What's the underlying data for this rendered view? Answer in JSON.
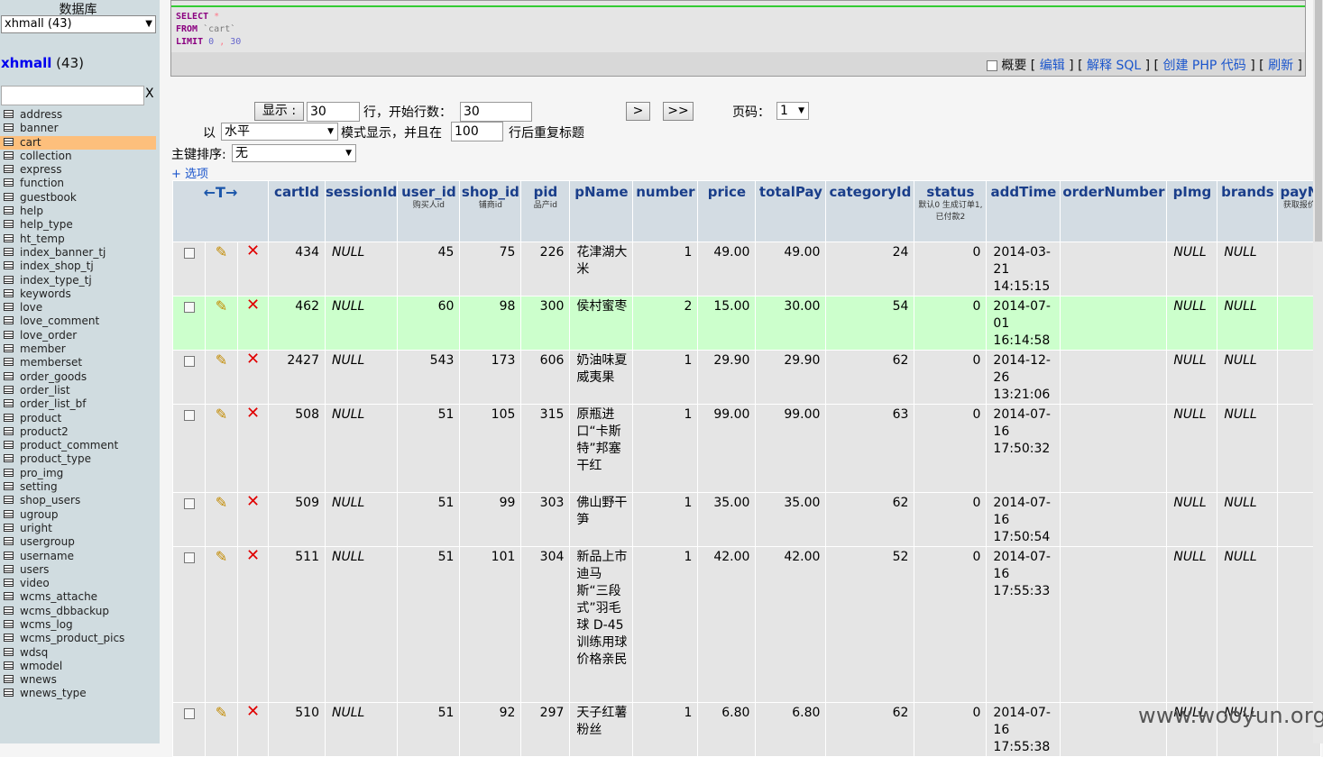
{
  "sidebar": {
    "db_label": "数据库",
    "db_select": "xhmall (43)",
    "db_name": "xhmall",
    "db_count": "(43)",
    "filter_value": "",
    "filter_clear": "X",
    "tables": [
      "address",
      "banner",
      "cart",
      "collection",
      "express",
      "function",
      "guestbook",
      "help",
      "help_type",
      "ht_temp",
      "index_banner_tj",
      "index_shop_tj",
      "index_type_tj",
      "keywords",
      "love",
      "love_comment",
      "love_order",
      "member",
      "memberset",
      "order_goods",
      "order_list",
      "order_list_bf",
      "product",
      "product2",
      "product_comment",
      "product_type",
      "pro_img",
      "setting",
      "shop_users",
      "ugroup",
      "uright",
      "usergroup",
      "username",
      "users",
      "video",
      "wcms_attache",
      "wcms_dbbackup",
      "wcms_log",
      "wcms_product_pics",
      "wdsq",
      "wmodel",
      "wnews",
      "wnews_type"
    ],
    "active_table": "cart"
  },
  "sql": {
    "select_kw": "SELECT",
    "star": "*",
    "from_kw": "FROM",
    "table": "`cart`",
    "limit_kw": "LIMIT",
    "limit_a": "0",
    "limit_b": "30",
    "profile_label": "概要",
    "bracket_open": "[",
    "bracket_close": "]",
    "edit": "编辑",
    "explain": "解释 SQL",
    "php": "创建 PHP 代码",
    "refresh": "刷新"
  },
  "nav": {
    "show_btn": "显示 :",
    "rows_value": "30",
    "rows_label": "行，开始行数：",
    "start_value": "30",
    "next_btn": ">",
    "last_btn": ">>",
    "page_label": "页码：",
    "page_value": "1",
    "mode_prefix": "以",
    "mode_value": "水平",
    "mode_label": "模式显示，并且在",
    "repeat_value": "100",
    "repeat_label": "行后重复标题",
    "sort_label": "主键排序:",
    "sort_value": "无",
    "options_link": "+ 选项"
  },
  "table": {
    "arrows": "←T→",
    "headers": [
      {
        "name": "cartId",
        "comment": ""
      },
      {
        "name": "sessionId",
        "comment": ""
      },
      {
        "name": "user_id",
        "comment": "购买人id"
      },
      {
        "name": "shop_id",
        "comment": "铺商id"
      },
      {
        "name": "pid",
        "comment": "品产id"
      },
      {
        "name": "pName",
        "comment": ""
      },
      {
        "name": "number",
        "comment": ""
      },
      {
        "name": "price",
        "comment": ""
      },
      {
        "name": "totalPay",
        "comment": ""
      },
      {
        "name": "categoryId",
        "comment": ""
      },
      {
        "name": "status",
        "comment": "默认0 生成订单1, 已付款2"
      },
      {
        "name": "addTime",
        "comment": ""
      },
      {
        "name": "orderNumber",
        "comment": ""
      },
      {
        "name": "pImg",
        "comment": ""
      },
      {
        "name": "brands",
        "comment": ""
      },
      {
        "name": "payN",
        "comment": "获取报价"
      }
    ],
    "rows": [
      {
        "cartId": "434",
        "sessionId": "NULL",
        "user_id": "45",
        "shop_id": "75",
        "pid": "226",
        "pName": "花津湖大米",
        "number": "1",
        "price": "49.00",
        "totalPay": "49.00",
        "categoryId": "24",
        "status": "0",
        "addTime": "2014-03-21 14:15:15",
        "orderNumber": "",
        "pImg": "NULL",
        "brands": "NULL",
        "payN": "",
        "highlight": false
      },
      {
        "cartId": "462",
        "sessionId": "NULL",
        "user_id": "60",
        "shop_id": "98",
        "pid": "300",
        "pName": "侯村蜜枣",
        "number": "2",
        "price": "15.00",
        "totalPay": "30.00",
        "categoryId": "54",
        "status": "0",
        "addTime": "2014-07-01 16:14:58",
        "orderNumber": "",
        "pImg": "NULL",
        "brands": "NULL",
        "payN": "",
        "highlight": true
      },
      {
        "cartId": "2427",
        "sessionId": "NULL",
        "user_id": "543",
        "shop_id": "173",
        "pid": "606",
        "pName": "奶油味夏威夷果",
        "number": "1",
        "price": "29.90",
        "totalPay": "29.90",
        "categoryId": "62",
        "status": "0",
        "addTime": "2014-12-26 13:21:06",
        "orderNumber": "",
        "pImg": "NULL",
        "brands": "NULL",
        "payN": "",
        "highlight": false
      },
      {
        "cartId": "508",
        "sessionId": "NULL",
        "user_id": "51",
        "shop_id": "105",
        "pid": "315",
        "pName": "原瓶进口“卡斯特”邦塞干红",
        "number": "1",
        "price": "99.00",
        "totalPay": "99.00",
        "categoryId": "63",
        "status": "0",
        "addTime": "2014-07-16 17:50:32",
        "orderNumber": "",
        "pImg": "NULL",
        "brands": "NULL",
        "payN": "",
        "highlight": false
      },
      {
        "cartId": "509",
        "sessionId": "NULL",
        "user_id": "51",
        "shop_id": "99",
        "pid": "303",
        "pName": "佛山野干笋",
        "number": "1",
        "price": "35.00",
        "totalPay": "35.00",
        "categoryId": "62",
        "status": "0",
        "addTime": "2014-07-16 17:50:54",
        "orderNumber": "",
        "pImg": "NULL",
        "brands": "NULL",
        "payN": "",
        "highlight": false
      },
      {
        "cartId": "511",
        "sessionId": "NULL",
        "user_id": "51",
        "shop_id": "101",
        "pid": "304",
        "pName": "新品上市 迪马斯“三段式”羽毛球 D-45训练用球 价格亲民",
        "number": "1",
        "price": "42.00",
        "totalPay": "42.00",
        "categoryId": "52",
        "status": "0",
        "addTime": "2014-07-16 17:55:33",
        "orderNumber": "",
        "pImg": "NULL",
        "brands": "NULL",
        "payN": "",
        "highlight": false
      },
      {
        "cartId": "510",
        "sessionId": "NULL",
        "user_id": "51",
        "shop_id": "92",
        "pid": "297",
        "pName": "天子红薯粉丝",
        "number": "1",
        "price": "6.80",
        "totalPay": "6.80",
        "categoryId": "62",
        "status": "0",
        "addTime": "2014-07-16 17:55:38",
        "orderNumber": "",
        "pImg": "NULL",
        "brands": "NULL",
        "payN": "",
        "highlight": false
      }
    ]
  },
  "watermark": "www.wooyun.org"
}
